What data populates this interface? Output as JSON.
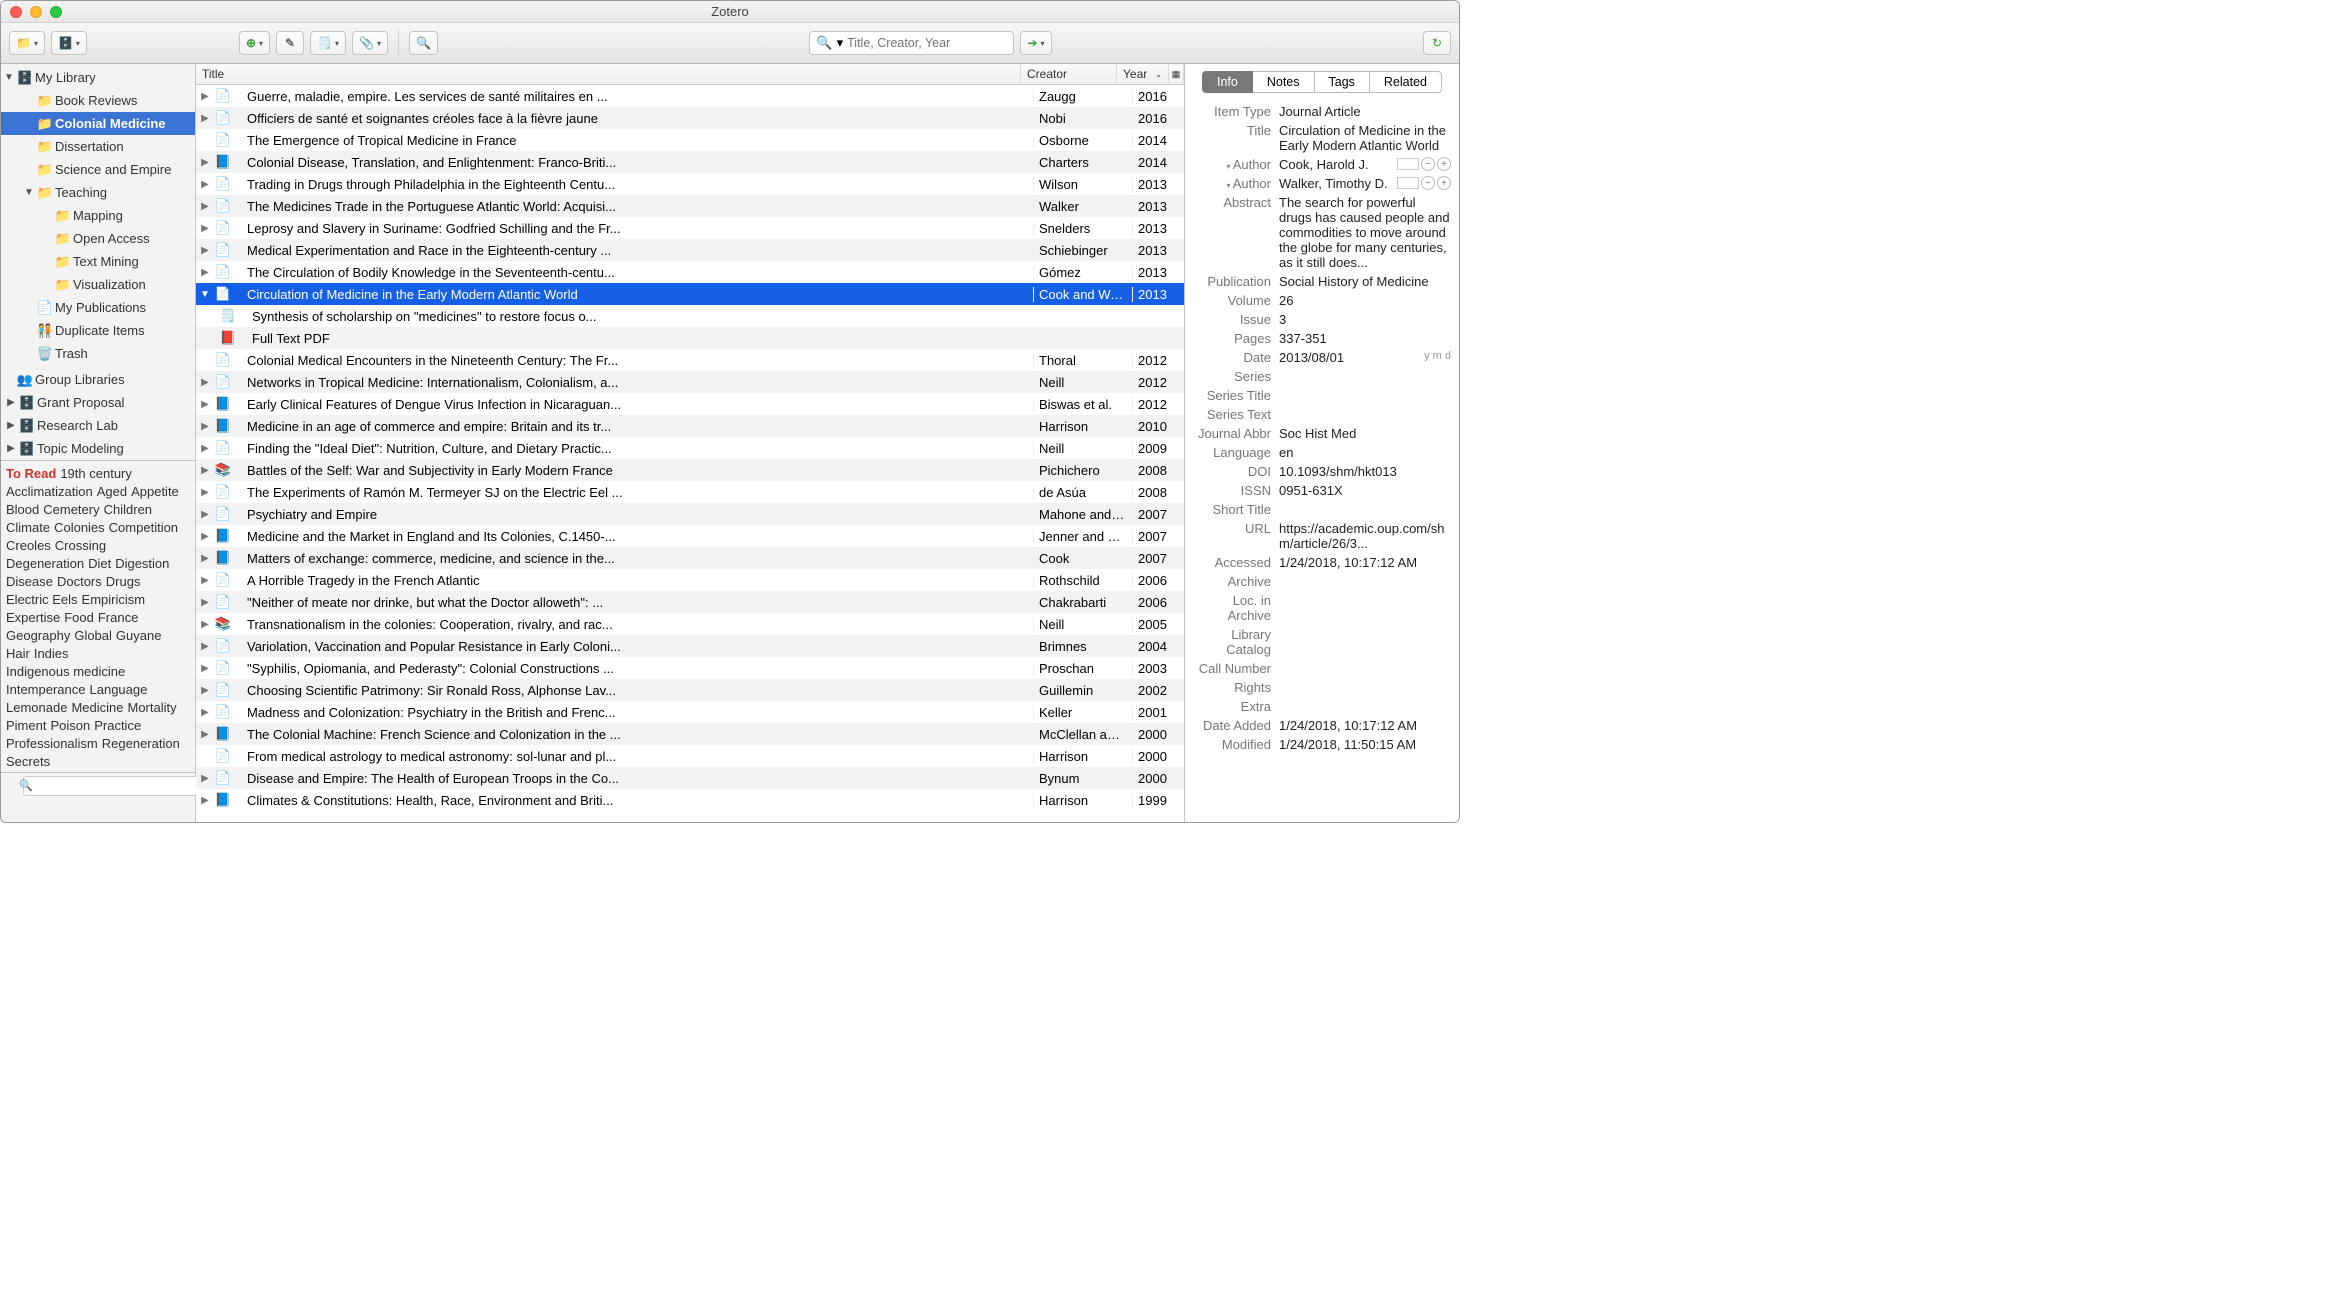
{
  "window": {
    "title": "Zotero"
  },
  "toolbar": {
    "search_placeholder": "Title, Creator, Year"
  },
  "sidebar": {
    "my_library": "My Library",
    "folders": [
      {
        "name": "Book Reviews",
        "indent": 1
      },
      {
        "name": "Colonial Medicine",
        "indent": 1,
        "selected": true
      },
      {
        "name": "Dissertation",
        "indent": 1
      },
      {
        "name": "Science and Empire",
        "indent": 1
      },
      {
        "name": "Teaching",
        "indent": 1,
        "expanded": true
      },
      {
        "name": "Mapping",
        "indent": 2
      },
      {
        "name": "Open Access",
        "indent": 2
      },
      {
        "name": "Text Mining",
        "indent": 2
      },
      {
        "name": "Visualization",
        "indent": 2
      }
    ],
    "my_pubs": "My Publications",
    "dup": "Duplicate Items",
    "trash": "Trash",
    "group_hdr": "Group Libraries",
    "groups": [
      {
        "name": "Grant Proposal"
      },
      {
        "name": "Research Lab"
      },
      {
        "name": "Topic Modeling"
      }
    ]
  },
  "tags": [
    "To Read",
    "19th century",
    "Acclimatization",
    "Aged",
    "Appetite",
    "Blood",
    "Cemetery",
    "Children",
    "Climate",
    "Colonies",
    "Competition",
    "Creoles",
    "Crossing",
    "Degeneration",
    "Diet",
    "Digestion",
    "Disease",
    "Doctors",
    "Drugs",
    "Electric Eels",
    "Empiricism",
    "Expertise",
    "Food",
    "France",
    "Geography",
    "Global",
    "Guyane",
    "Hair",
    "Indies",
    "Indigenous medicine",
    "Intemperance",
    "Language",
    "Lemonade",
    "Medicine",
    "Mortality",
    "Piment",
    "Poison",
    "Practice",
    "Professionalism",
    "Regeneration",
    "Secrets"
  ],
  "columns": {
    "title": "Title",
    "creator": "Creator",
    "year": "Year"
  },
  "items": [
    {
      "expand": "▶",
      "type": "file",
      "color": "#e36054",
      "title": "Guerre, maladie, empire. Les services de santé militaires en ...",
      "creator": "Zaugg",
      "year": "2016"
    },
    {
      "expand": "▶",
      "type": "file",
      "color": "#e36054",
      "title": "Officiers de santé et soignantes créoles face à la fièvre jaune",
      "creator": "Nobi",
      "year": "2016"
    },
    {
      "expand": "",
      "type": "file",
      "title": "The Emergence of Tropical Medicine in France",
      "creator": "Osborne",
      "year": "2014"
    },
    {
      "expand": "▶",
      "type": "book",
      "title": "Colonial Disease, Translation, and Enlightenment: Franco-Briti...",
      "creator": "Charters",
      "year": "2014"
    },
    {
      "expand": "▶",
      "type": "file",
      "title": "Trading in Drugs through Philadelphia in the Eighteenth Centu...",
      "creator": "Wilson",
      "year": "2013"
    },
    {
      "expand": "▶",
      "type": "file",
      "title": "The Medicines Trade in the Portuguese Atlantic World: Acquisi...",
      "creator": "Walker",
      "year": "2013"
    },
    {
      "expand": "▶",
      "type": "file",
      "title": "Leprosy and Slavery in Suriname: Godfried Schilling and the Fr...",
      "creator": "Snelders",
      "year": "2013"
    },
    {
      "expand": "▶",
      "type": "file",
      "title": "Medical Experimentation and Race in the Eighteenth-century ...",
      "creator": "Schiebinger",
      "year": "2013"
    },
    {
      "expand": "▶",
      "type": "file",
      "title": "The Circulation of Bodily Knowledge in the Seventeenth-centu...",
      "creator": "Gómez",
      "year": "2013"
    },
    {
      "expand": "▼",
      "type": "file",
      "title": "Circulation of Medicine in the Early Modern Atlantic World",
      "creator": "Cook and Walker",
      "year": "2013",
      "selected": true
    },
    {
      "expand": "",
      "type": "note",
      "title": "Synthesis of scholarship on \"medicines\" to restore focus o...",
      "creator": "",
      "year": "",
      "child": true
    },
    {
      "expand": "",
      "type": "pdf",
      "title": "Full Text PDF",
      "creator": "",
      "year": "",
      "child": true
    },
    {
      "expand": "",
      "type": "file",
      "title": "Colonial Medical Encounters in the Nineteenth Century: The Fr...",
      "creator": "Thoral",
      "year": "2012"
    },
    {
      "expand": "▶",
      "type": "file",
      "title": "Networks in Tropical Medicine: Internationalism, Colonialism, a...",
      "creator": "Neill",
      "year": "2012"
    },
    {
      "expand": "▶",
      "type": "book",
      "title": "Early Clinical Features of Dengue Virus Infection in Nicaraguan...",
      "creator": "Biswas et al.",
      "year": "2012"
    },
    {
      "expand": "▶",
      "type": "book",
      "title": "Medicine in an age of commerce and empire: Britain and its tr...",
      "creator": "Harrison",
      "year": "2010"
    },
    {
      "expand": "▶",
      "type": "file",
      "title": "Finding the \"Ideal Diet\": Nutrition, Culture, and Dietary Practic...",
      "creator": "Neill",
      "year": "2009"
    },
    {
      "expand": "▶",
      "type": "book2",
      "title": "Battles of the Self: War and Subjectivity in Early Modern France",
      "creator": "Pichichero",
      "year": "2008"
    },
    {
      "expand": "▶",
      "type": "file",
      "title": "The Experiments of Ramón M. Termeyer SJ on the Electric Eel ...",
      "creator": "de Asúa",
      "year": "2008"
    },
    {
      "expand": "▶",
      "type": "file",
      "title": "Psychiatry and Empire",
      "creator": "Mahone and Vaughan",
      "year": "2007"
    },
    {
      "expand": "▶",
      "type": "book",
      "title": "Medicine and the Market in England and Its Colonies, C.1450-...",
      "creator": "Jenner and Wallis",
      "year": "2007"
    },
    {
      "expand": "▶",
      "type": "book",
      "title": "Matters of exchange: commerce, medicine, and science in the...",
      "creator": "Cook",
      "year": "2007"
    },
    {
      "expand": "▶",
      "type": "file",
      "title": "A Horrible Tragedy in the French Atlantic",
      "creator": "Rothschild",
      "year": "2006"
    },
    {
      "expand": "▶",
      "type": "file",
      "title": "\"Neither of meate nor drinke, but what the Doctor alloweth\": ...",
      "creator": "Chakrabarti",
      "year": "2006"
    },
    {
      "expand": "▶",
      "type": "book2",
      "title": "Transnationalism in the colonies: Cooperation, rivalry, and rac...",
      "creator": "Neill",
      "year": "2005"
    },
    {
      "expand": "▶",
      "type": "file",
      "title": "Variolation, Vaccination and Popular Resistance in Early Coloni...",
      "creator": "Brimnes",
      "year": "2004"
    },
    {
      "expand": "▶",
      "type": "file",
      "title": "\"Syphilis, Opiomania, and Pederasty\": Colonial Constructions ...",
      "creator": "Proschan",
      "year": "2003"
    },
    {
      "expand": "▶",
      "type": "file",
      "title": "Choosing Scientific Patrimony: Sir Ronald Ross, Alphonse Lav...",
      "creator": "Guillemin",
      "year": "2002"
    },
    {
      "expand": "▶",
      "type": "file",
      "title": "Madness and Colonization: Psychiatry in the British and Frenc...",
      "creator": "Keller",
      "year": "2001"
    },
    {
      "expand": "▶",
      "type": "book",
      "title": "The Colonial Machine: French Science and Colonization in the ...",
      "creator": "McClellan and Rego...",
      "year": "2000"
    },
    {
      "expand": "",
      "type": "file",
      "title": "From medical astrology to medical astronomy: sol-lunar and pl...",
      "creator": "Harrison",
      "year": "2000"
    },
    {
      "expand": "▶",
      "type": "file",
      "title": "Disease and Empire: The Health of European Troops in the Co...",
      "creator": "Bynum",
      "year": "2000"
    },
    {
      "expand": "▶",
      "type": "book",
      "title": "Climates & Constitutions: Health, Race, Environment and Briti...",
      "creator": "Harrison",
      "year": "1999"
    }
  ],
  "right_tabs": [
    "Info",
    "Notes",
    "Tags",
    "Related"
  ],
  "info": {
    "item_type": {
      "label": "Item Type",
      "value": "Journal Article"
    },
    "title": {
      "label": "Title",
      "value": "Circulation of Medicine in the Early Modern Atlantic World"
    },
    "author1": {
      "label": "Author",
      "value": "Cook, Harold J."
    },
    "author2": {
      "label": "Author",
      "value": "Walker, Timothy D."
    },
    "abstract": {
      "label": "Abstract",
      "value": "The search for powerful drugs has caused people and commodities to move around the globe for many centuries, as it still does..."
    },
    "publication": {
      "label": "Publication",
      "value": "Social History of Medicine"
    },
    "volume": {
      "label": "Volume",
      "value": "26"
    },
    "issue": {
      "label": "Issue",
      "value": "3"
    },
    "pages": {
      "label": "Pages",
      "value": "337-351"
    },
    "date": {
      "label": "Date",
      "value": "2013/08/01",
      "note": "y m d"
    },
    "series": {
      "label": "Series",
      "value": ""
    },
    "series_title": {
      "label": "Series Title",
      "value": ""
    },
    "series_text": {
      "label": "Series Text",
      "value": ""
    },
    "journal_abbr": {
      "label": "Journal Abbr",
      "value": "Soc Hist Med"
    },
    "language": {
      "label": "Language",
      "value": "en"
    },
    "doi": {
      "label": "DOI",
      "value": "10.1093/shm/hkt013"
    },
    "issn": {
      "label": "ISSN",
      "value": "0951-631X"
    },
    "short_title": {
      "label": "Short Title",
      "value": ""
    },
    "url": {
      "label": "URL",
      "value": "https://academic.oup.com/shm/article/26/3..."
    },
    "accessed": {
      "label": "Accessed",
      "value": "1/24/2018, 10:17:12 AM"
    },
    "archive": {
      "label": "Archive",
      "value": ""
    },
    "loc_archive": {
      "label": "Loc. in Archive",
      "value": ""
    },
    "library_catalog": {
      "label": "Library Catalog",
      "value": ""
    },
    "call_number": {
      "label": "Call Number",
      "value": ""
    },
    "rights": {
      "label": "Rights",
      "value": ""
    },
    "extra": {
      "label": "Extra",
      "value": ""
    },
    "date_added": {
      "label": "Date Added",
      "value": "1/24/2018, 10:17:12 AM"
    },
    "modified": {
      "label": "Modified",
      "value": "1/24/2018, 11:50:15 AM"
    }
  }
}
